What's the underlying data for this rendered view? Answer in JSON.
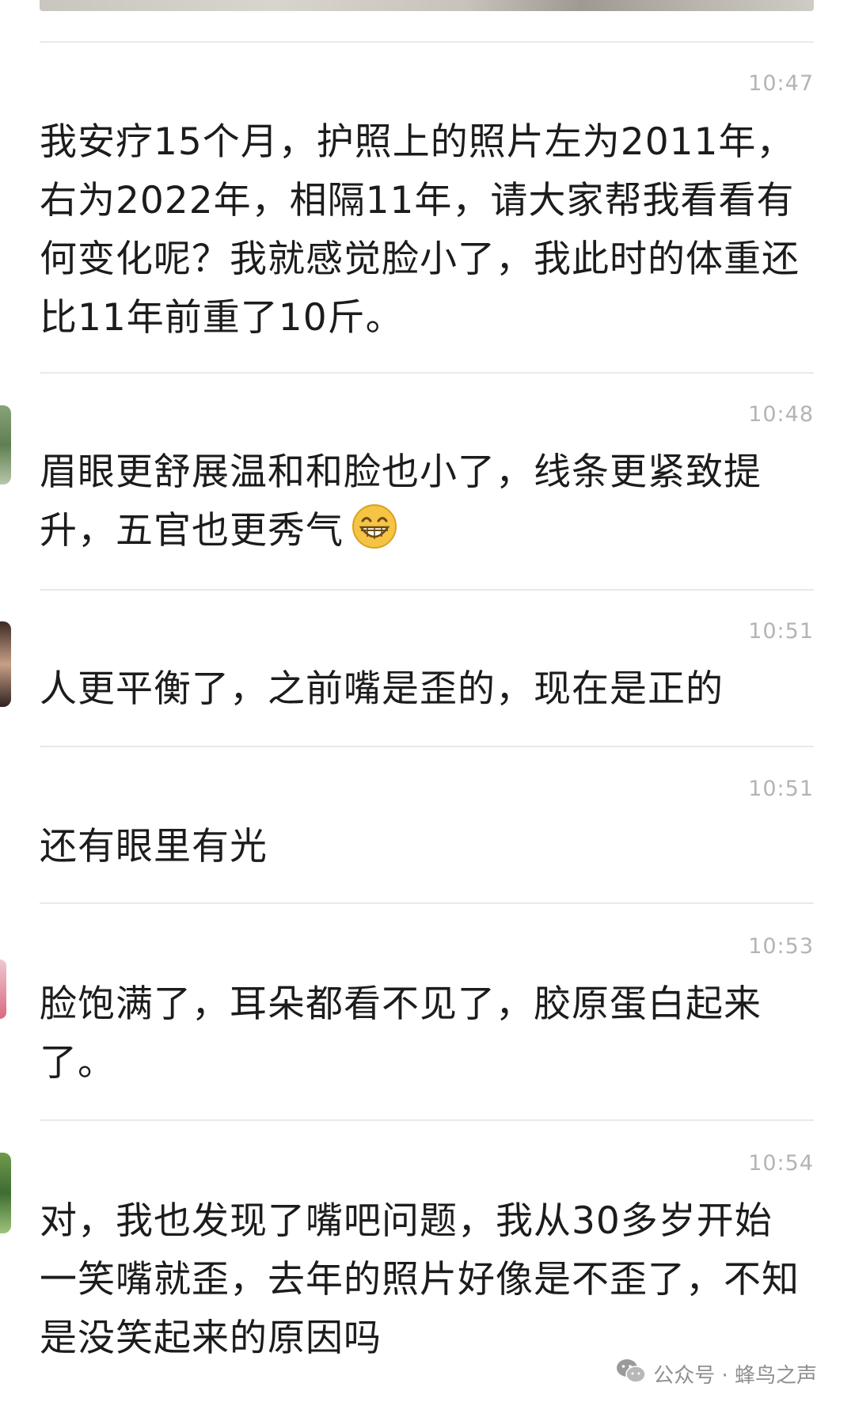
{
  "comments": [
    {
      "time": "10:47",
      "text": "我安疗15个月，护照上的照片左为2011年，右为2022年，相隔11年，请大家帮我看看有何变化呢？我就感觉脸小了，我此时的体重还比11年前重了10斤。"
    },
    {
      "time": "10:48",
      "text": "眉眼更舒展温和和脸也小了，线条更紧致提升，五官也更秀气",
      "emoji": "grinning-face-icon"
    },
    {
      "time": "10:51",
      "text": "人更平衡了，之前嘴是歪的，现在是正的"
    },
    {
      "time": "10:51",
      "text": "还有眼里有光"
    },
    {
      "time": "10:53",
      "text": "脸饱满了，耳朵都看不见了，胶原蛋白起来了。"
    },
    {
      "time": "10:54",
      "text": "对，我也发现了嘴吧问题，我从30多岁开始一笑嘴就歪，去年的照片好像是不歪了，不知是没笑起来的原因吗"
    }
  ],
  "watermark": {
    "text": "公众号 · 蜂鸟之声",
    "icon": "wechat-icon"
  }
}
